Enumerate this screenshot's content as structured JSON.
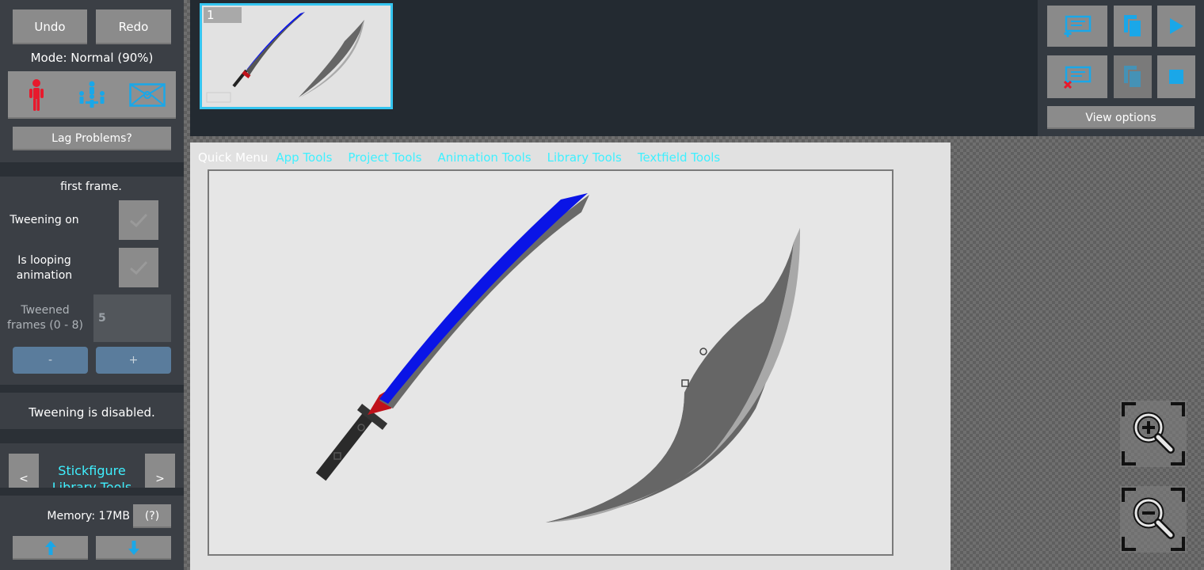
{
  "sidebar": {
    "undo_label": "Undo",
    "redo_label": "Redo",
    "mode_text": "Mode: Normal (90%)",
    "mode_icons": [
      "stickfigure-icon",
      "group-stickfigures-icon",
      "envelope-icon"
    ],
    "lag_label": "Lag Problems?",
    "partial_text": "first frame.",
    "tweening_on_label": "Tweening on",
    "looping_label": "Is looping animation",
    "tweened_frames_label": "Tweened frames (0 - 8)",
    "tweened_frames_value": "5",
    "minus_label": "-",
    "plus_label": "+",
    "tweening_status": "Tweening is disabled.",
    "prev_label": "<",
    "next_label": ">",
    "library_title": "Stickfigure Library Tools",
    "memory_text": "Memory: 17MB",
    "help_label": "(?)"
  },
  "timeline": {
    "frame_number": "1"
  },
  "controls": {
    "view_options_label": "View options"
  },
  "menu": {
    "items": [
      "Quick Menu",
      "App Tools",
      "Project Tools",
      "Animation Tools",
      "Library Tools",
      "Textfield Tools"
    ]
  },
  "colors": {
    "accent_cyan": "#3ff0ff",
    "icon_blue": "#1aa7e8",
    "blade_blue": "#0a14e6",
    "guard_red": "#c0121b"
  }
}
